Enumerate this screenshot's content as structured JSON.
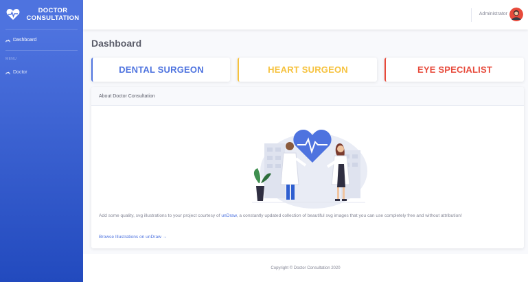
{
  "sidebar": {
    "brand_line1": "DOCTOR",
    "brand_line2": "CONSULTATION",
    "brand_icon": "heartbeat-icon",
    "items": [
      {
        "label": "Dashboard",
        "icon": "dashboard-icon",
        "active": true
      }
    ],
    "menu_heading": "MENU",
    "menu_items": [
      {
        "label": "Doctor",
        "icon": "doctor-icon"
      }
    ]
  },
  "topbar": {
    "user_name": "Administrator"
  },
  "main": {
    "page_title": "Dashboard",
    "specialties": [
      {
        "label": "DENTAL SURGEON",
        "color": "#4e73df"
      },
      {
        "label": "HEART SURGEON",
        "color": "#f6c23e"
      },
      {
        "label": "EYE SPECIALIST",
        "color": "#e74a3b"
      }
    ],
    "card": {
      "title": "About Doctor Consultation",
      "text_before": "Add some quality, svg illustrations to your project courtesy of ",
      "link_text": "unDraw",
      "text_after": ", a constantly updated collection of beautiful svg images that you can use completely free and without attribution!",
      "browse_link": "Browse Illustrations on unDraw →"
    }
  },
  "footer": {
    "copyright": "Copyright © Doctor Consultation 2020"
  },
  "colors": {
    "primary": "#4e73df",
    "warning": "#f6c23e",
    "danger": "#e74a3b"
  }
}
